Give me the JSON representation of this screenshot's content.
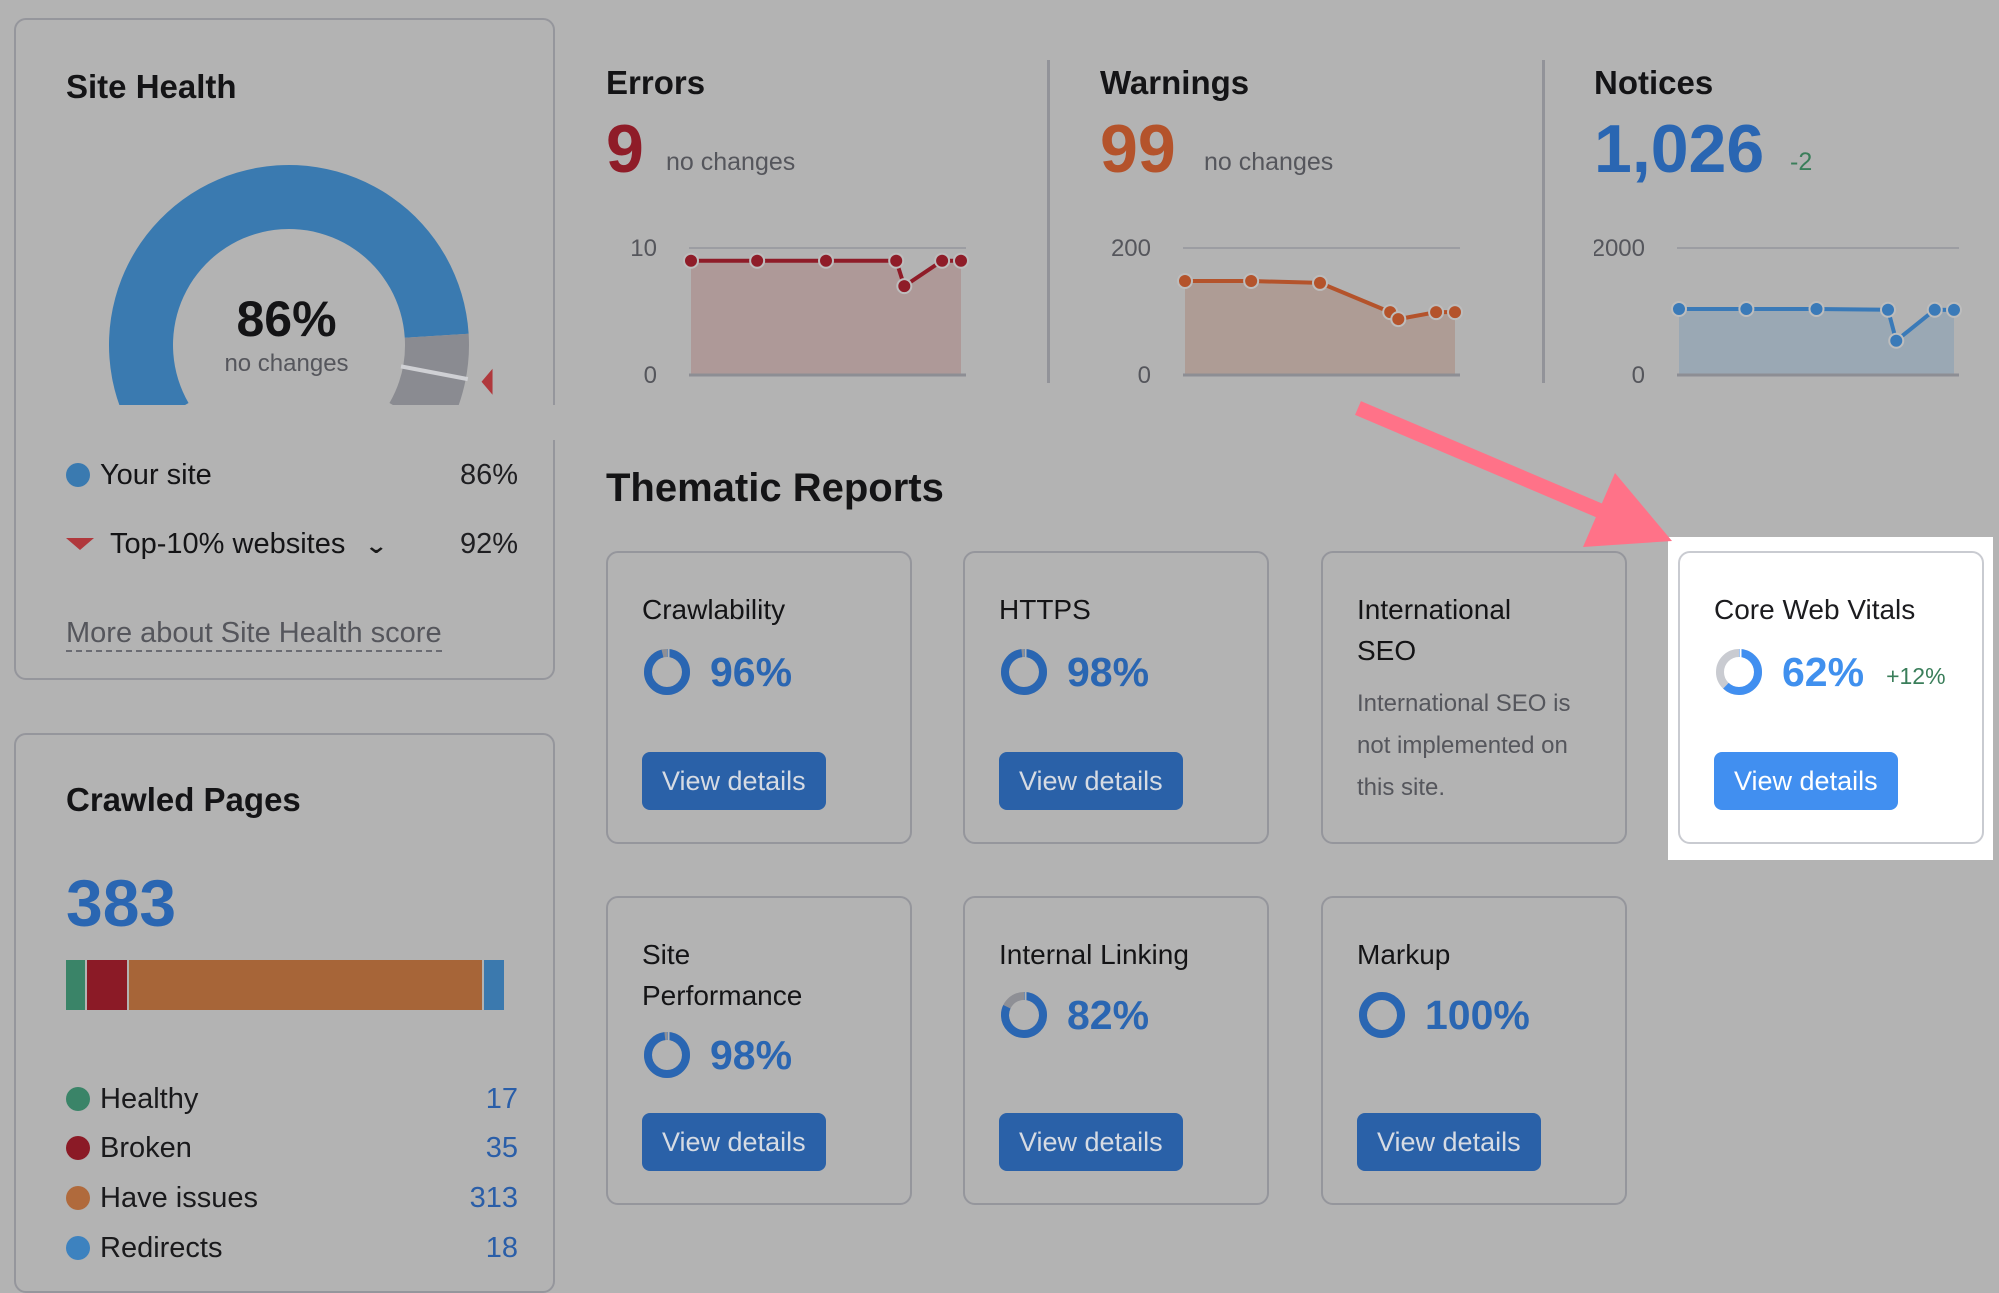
{
  "colors": {
    "site_blue": "#3a7ab0",
    "gauge_gray": "#8a8b91",
    "top10_red": "#b0383c",
    "errors_red": "#8f1c28",
    "warnings_orange": "#b4532b",
    "notices_blue": "#2a66b2",
    "healthy_green": "#3a8468",
    "broken_red": "#8b1a26",
    "issues_orange": "#a76538",
    "redirects_blue": "#3b79ae",
    "highlight_arrow": "#ff7288",
    "button_blue": "#2a61a8",
    "button_blue_active": "#418ff0",
    "score_gray": "#8e8f95",
    "score_gray_light": "#c9cbd1"
  },
  "site_health": {
    "title": "Site Health",
    "score_label": "86%",
    "score": 86,
    "change": "no changes",
    "legend": [
      {
        "label": "Your site",
        "value": "86%"
      },
      {
        "label": "Top-10% websites",
        "value": "92%"
      }
    ],
    "top10_score": 92,
    "more_link": "More about Site Health score"
  },
  "crawled_pages": {
    "title": "Crawled Pages",
    "total": "383",
    "segments": [
      {
        "label": "Healthy",
        "value": 17,
        "display": "17",
        "color": "#3a8468"
      },
      {
        "label": "Broken",
        "value": 35,
        "display": "35",
        "color": "#8b1a26"
      },
      {
        "label": "Have issues",
        "value": 313,
        "display": "313",
        "color": "#a76538"
      },
      {
        "label": "Redirects",
        "value": 18,
        "display": "18",
        "color": "#3b79ae"
      }
    ]
  },
  "metrics": [
    {
      "title": "Errors",
      "value": "9",
      "change": "no changes",
      "color": "#8f1c28",
      "change_color": "#55565c"
    },
    {
      "title": "Warnings",
      "value": "99",
      "change": "no changes",
      "color": "#b4532b",
      "change_color": "#55565c"
    },
    {
      "title": "Notices",
      "value": "1,026",
      "change": "-2",
      "color": "#2a66b2",
      "change_color": "#3a7e5a"
    }
  ],
  "chart_data": [
    {
      "type": "area",
      "title": "Errors",
      "x": [
        1,
        2,
        3,
        4,
        5,
        6,
        7
      ],
      "values": [
        9,
        9,
        9,
        9,
        7,
        9,
        9
      ],
      "ylim": [
        0,
        10
      ],
      "yticks": [
        "10",
        "0"
      ],
      "grid": true,
      "color": "#8f1c28",
      "fill": "#ae9998"
    },
    {
      "type": "area",
      "title": "Warnings",
      "x": [
        1,
        2,
        3,
        4,
        5,
        6,
        7
      ],
      "values": [
        148,
        148,
        145,
        99,
        88,
        99,
        99
      ],
      "ylim": [
        0,
        200
      ],
      "yticks": [
        "200",
        "0"
      ],
      "grid": true,
      "color": "#b4532b",
      "fill": "#ae9c95"
    },
    {
      "type": "area",
      "title": "Notices",
      "x": [
        1,
        2,
        3,
        4,
        5,
        6,
        7
      ],
      "values": [
        1040,
        1040,
        1040,
        1028,
        540,
        1028,
        1026
      ],
      "ylim": [
        0,
        2000
      ],
      "yticks": [
        "2000",
        "0"
      ],
      "grid": true,
      "color": "#3a7ab8",
      "fill": "#9aa8b4"
    }
  ],
  "thematic": {
    "heading": "Thematic Reports",
    "button_label": "View details",
    "cards": [
      {
        "title": "Crawlability",
        "pct": "96%",
        "score": 96
      },
      {
        "title": "HTTPS",
        "pct": "98%",
        "score": 98
      },
      {
        "title": "International SEO",
        "description": "International SEO is not implemented on this site."
      },
      {
        "title": "Core Web Vitals",
        "pct": "62%",
        "score": 62,
        "delta": "+12%"
      },
      {
        "title": "Site Performance",
        "pct": "98%",
        "score": 98
      },
      {
        "title": "Internal Linking",
        "pct": "82%",
        "score": 82
      },
      {
        "title": "Markup",
        "pct": "100%",
        "score": 100
      }
    ]
  }
}
